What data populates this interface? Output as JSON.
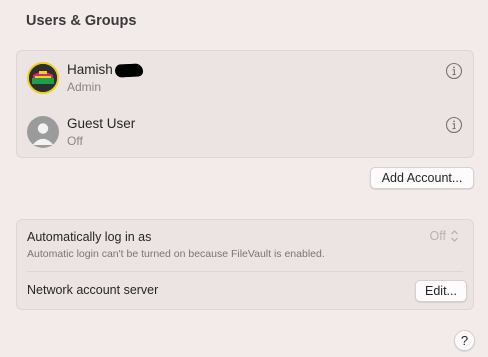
{
  "header": {
    "title": "Users & Groups"
  },
  "users": [
    {
      "name": "Hamish",
      "role": "Admin",
      "avatar": "admin-avatar-graphic",
      "info_icon": "info-icon"
    },
    {
      "name": "Guest User",
      "role": "Off",
      "avatar": "guest-silhouette",
      "info_icon": "info-icon"
    }
  ],
  "actions": {
    "add_account_label": "Add Account..."
  },
  "login": {
    "auto_label": "Automatically log in as",
    "auto_value": "Off",
    "auto_description": "Automatic login can't be turned on because FileVault is enabled.",
    "network_label": "Network account server",
    "edit_label": "Edit..."
  },
  "help": {
    "label": "?"
  },
  "colors": {
    "background": "#f2ebea",
    "card": "#ebe4e3",
    "button": "#fdfbfb",
    "avatar_ring": "#e9d21b"
  }
}
